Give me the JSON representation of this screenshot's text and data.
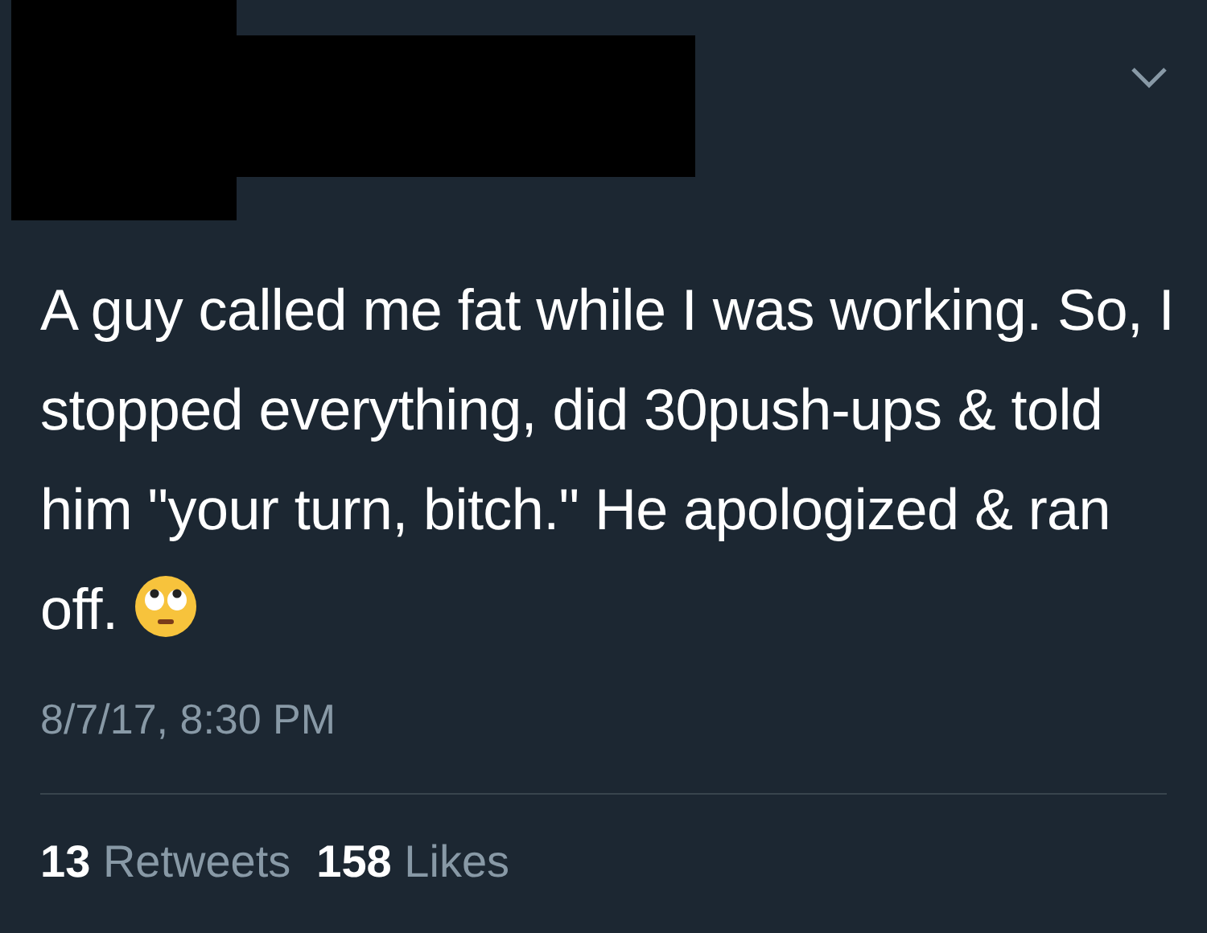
{
  "tweet": {
    "text": "A guy called me fat while I was working. So, I stopped everything, did 30push-ups & told him \"your turn, bitch.\" He apologized & ran off.",
    "timestamp": "8/7/17, 8:30 PM",
    "retweets": {
      "count": "13",
      "label": "Retweets"
    },
    "likes": {
      "count": "158",
      "label": "Likes"
    }
  }
}
